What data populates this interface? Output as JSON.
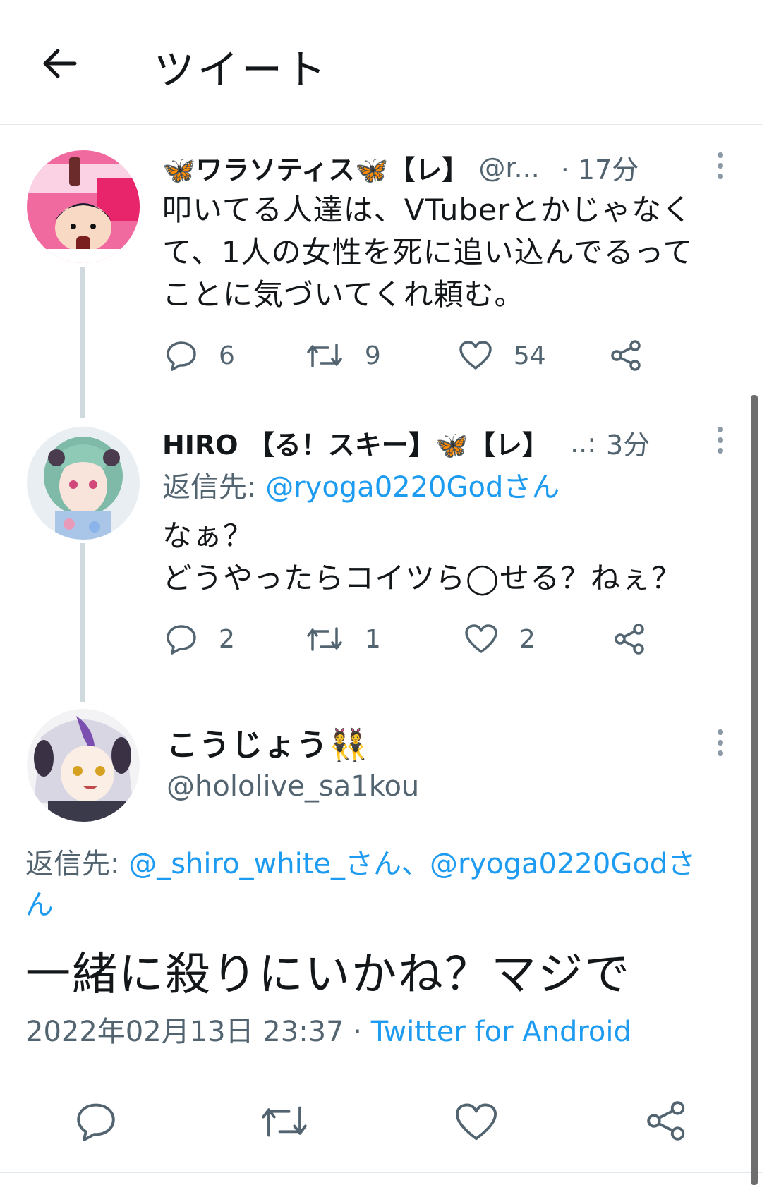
{
  "header": {
    "title": "ツイート"
  },
  "tweets": [
    {
      "display_name": "🦋ワラソティス🦋【レ】",
      "handle": "@r...",
      "time": "· 17分",
      "text": "叩いてる人達は、VTuberとかじゃなく\nて、1人の女性を死に追い込んでるって\nことに気づいてくれ頼む。",
      "replies": "6",
      "retweets": "9",
      "likes": "54"
    },
    {
      "display_name": "HIRO 【る！スキー】🦋【レ】",
      "handle": "..:",
      "time": "3分",
      "reply_label": "返信先:",
      "reply_to": "@ryoga0220Godさん",
      "text": "なぁ？\nどうやったらコイツら◯せる？ねぇ？",
      "replies": "2",
      "retweets": "1",
      "likes": "2"
    }
  ],
  "main_tweet": {
    "display_name": "こうじょう👯",
    "handle": "@hololive_sa1kou",
    "reply_label": "返信先:",
    "reply_to_1": "@_shiro_white_さん",
    "reply_sep": "、",
    "reply_to_2": "@ryoga0220Godさん",
    "text": "一緒に殺りにいかね？マジで",
    "timestamp": "2022年02月13日 23:37 · ",
    "source": "Twitter for Android"
  },
  "colors": {
    "accent": "#1d9bf0",
    "muted": "#536471",
    "thread_line": "#cfd9de"
  }
}
